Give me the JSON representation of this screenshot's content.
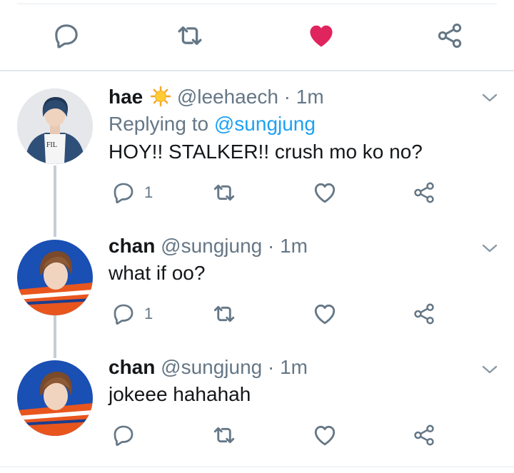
{
  "colors": {
    "text": "#14171a",
    "muted": "#657786",
    "link": "#1da1f2",
    "like_active": "#e0245e",
    "icon": "#657786",
    "thread_line": "#c4cfd6"
  },
  "icons": {
    "reply": "reply-icon",
    "retweet": "retweet-icon",
    "like": "heart-icon",
    "share": "share-icon",
    "more": "chevron-down-icon",
    "sun_emoji": "sun-emoji"
  },
  "main_tweet_actions": {
    "liked": true
  },
  "replies": [
    {
      "name": "hae",
      "has_emoji": true,
      "handle": "@leehaech",
      "separator": "·",
      "time": "1m",
      "replying_prefix": "Replying to",
      "replying_to": "@sungjung",
      "text": "HOY!! STALKER!! crush mo ko no?",
      "reply_count": "1"
    },
    {
      "name": "chan",
      "handle": "@sungjung",
      "separator": "·",
      "time": "1m",
      "text": "what if oo?",
      "reply_count": "1"
    },
    {
      "name": "chan",
      "handle": "@sungjung",
      "separator": "·",
      "time": "1m",
      "text": "jokeee hahahah",
      "reply_count": ""
    }
  ]
}
